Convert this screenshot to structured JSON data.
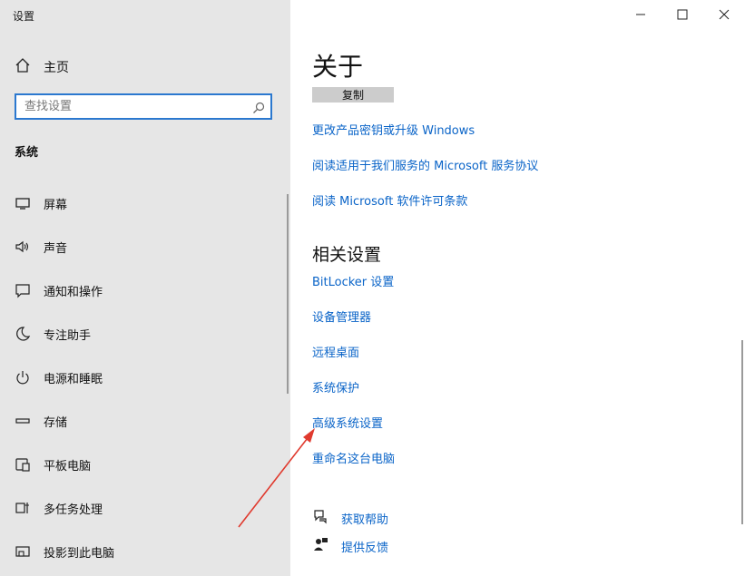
{
  "window": {
    "title": "设置",
    "minimize_icon": "minimize-icon",
    "maximize_icon": "maximize-icon",
    "close_icon": "close-icon"
  },
  "sidebar": {
    "home_label": "主页",
    "search_placeholder": "查找设置",
    "section_title": "系统",
    "items": [
      {
        "label": "屏幕",
        "icon": "monitor-icon"
      },
      {
        "label": "声音",
        "icon": "speaker-icon"
      },
      {
        "label": "通知和操作",
        "icon": "notification-icon"
      },
      {
        "label": "专注助手",
        "icon": "moon-icon"
      },
      {
        "label": "电源和睡眠",
        "icon": "power-icon"
      },
      {
        "label": "存储",
        "icon": "storage-icon"
      },
      {
        "label": "平板电脑",
        "icon": "tablet-icon"
      },
      {
        "label": "多任务处理",
        "icon": "multitask-icon"
      },
      {
        "label": "投影到此电脑",
        "icon": "project-icon"
      }
    ]
  },
  "main": {
    "title": "关于",
    "copy_button": "复制",
    "links": [
      "更改产品密钥或升级 Windows",
      "阅读适用于我们服务的 Microsoft 服务协议",
      "阅读 Microsoft 软件许可条款"
    ],
    "related_title": "相关设置",
    "related_links": [
      "BitLocker 设置",
      "设备管理器",
      "远程桌面",
      "系统保护",
      "高级系统设置",
      "重命名这台电脑"
    ],
    "help": [
      {
        "label": "获取帮助",
        "icon": "help-chat-icon"
      },
      {
        "label": "提供反馈",
        "icon": "feedback-icon"
      }
    ]
  },
  "colors": {
    "sidebar_bg": "#e6e6e6",
    "link": "#0a64c8",
    "search_border": "#2b78cf",
    "annotation_arrow": "#e03a2e"
  }
}
